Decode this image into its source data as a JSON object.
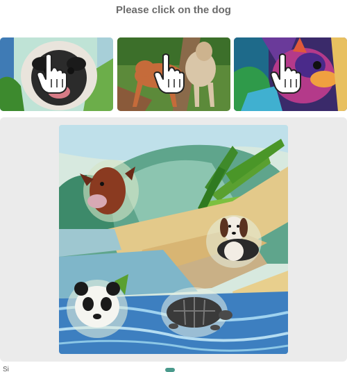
{
  "challenge": {
    "prompt": "Please click on the dog"
  },
  "examples": [
    {
      "label": "dog-example-pug",
      "icon": "pointing-hand-icon"
    },
    {
      "label": "dog-example-running",
      "icon": "pointing-hand-icon"
    },
    {
      "label": "dog-example-colorful",
      "icon": "pointing-hand-icon"
    }
  ],
  "scene": {
    "animals": [
      "cow",
      "dog",
      "panda",
      "turtle"
    ]
  },
  "footer": {
    "text": "Si"
  },
  "colors": {
    "prompt_text": "#6b6b6b",
    "panel_bg": "#ebebeb",
    "accent": "#4a9a8c"
  }
}
